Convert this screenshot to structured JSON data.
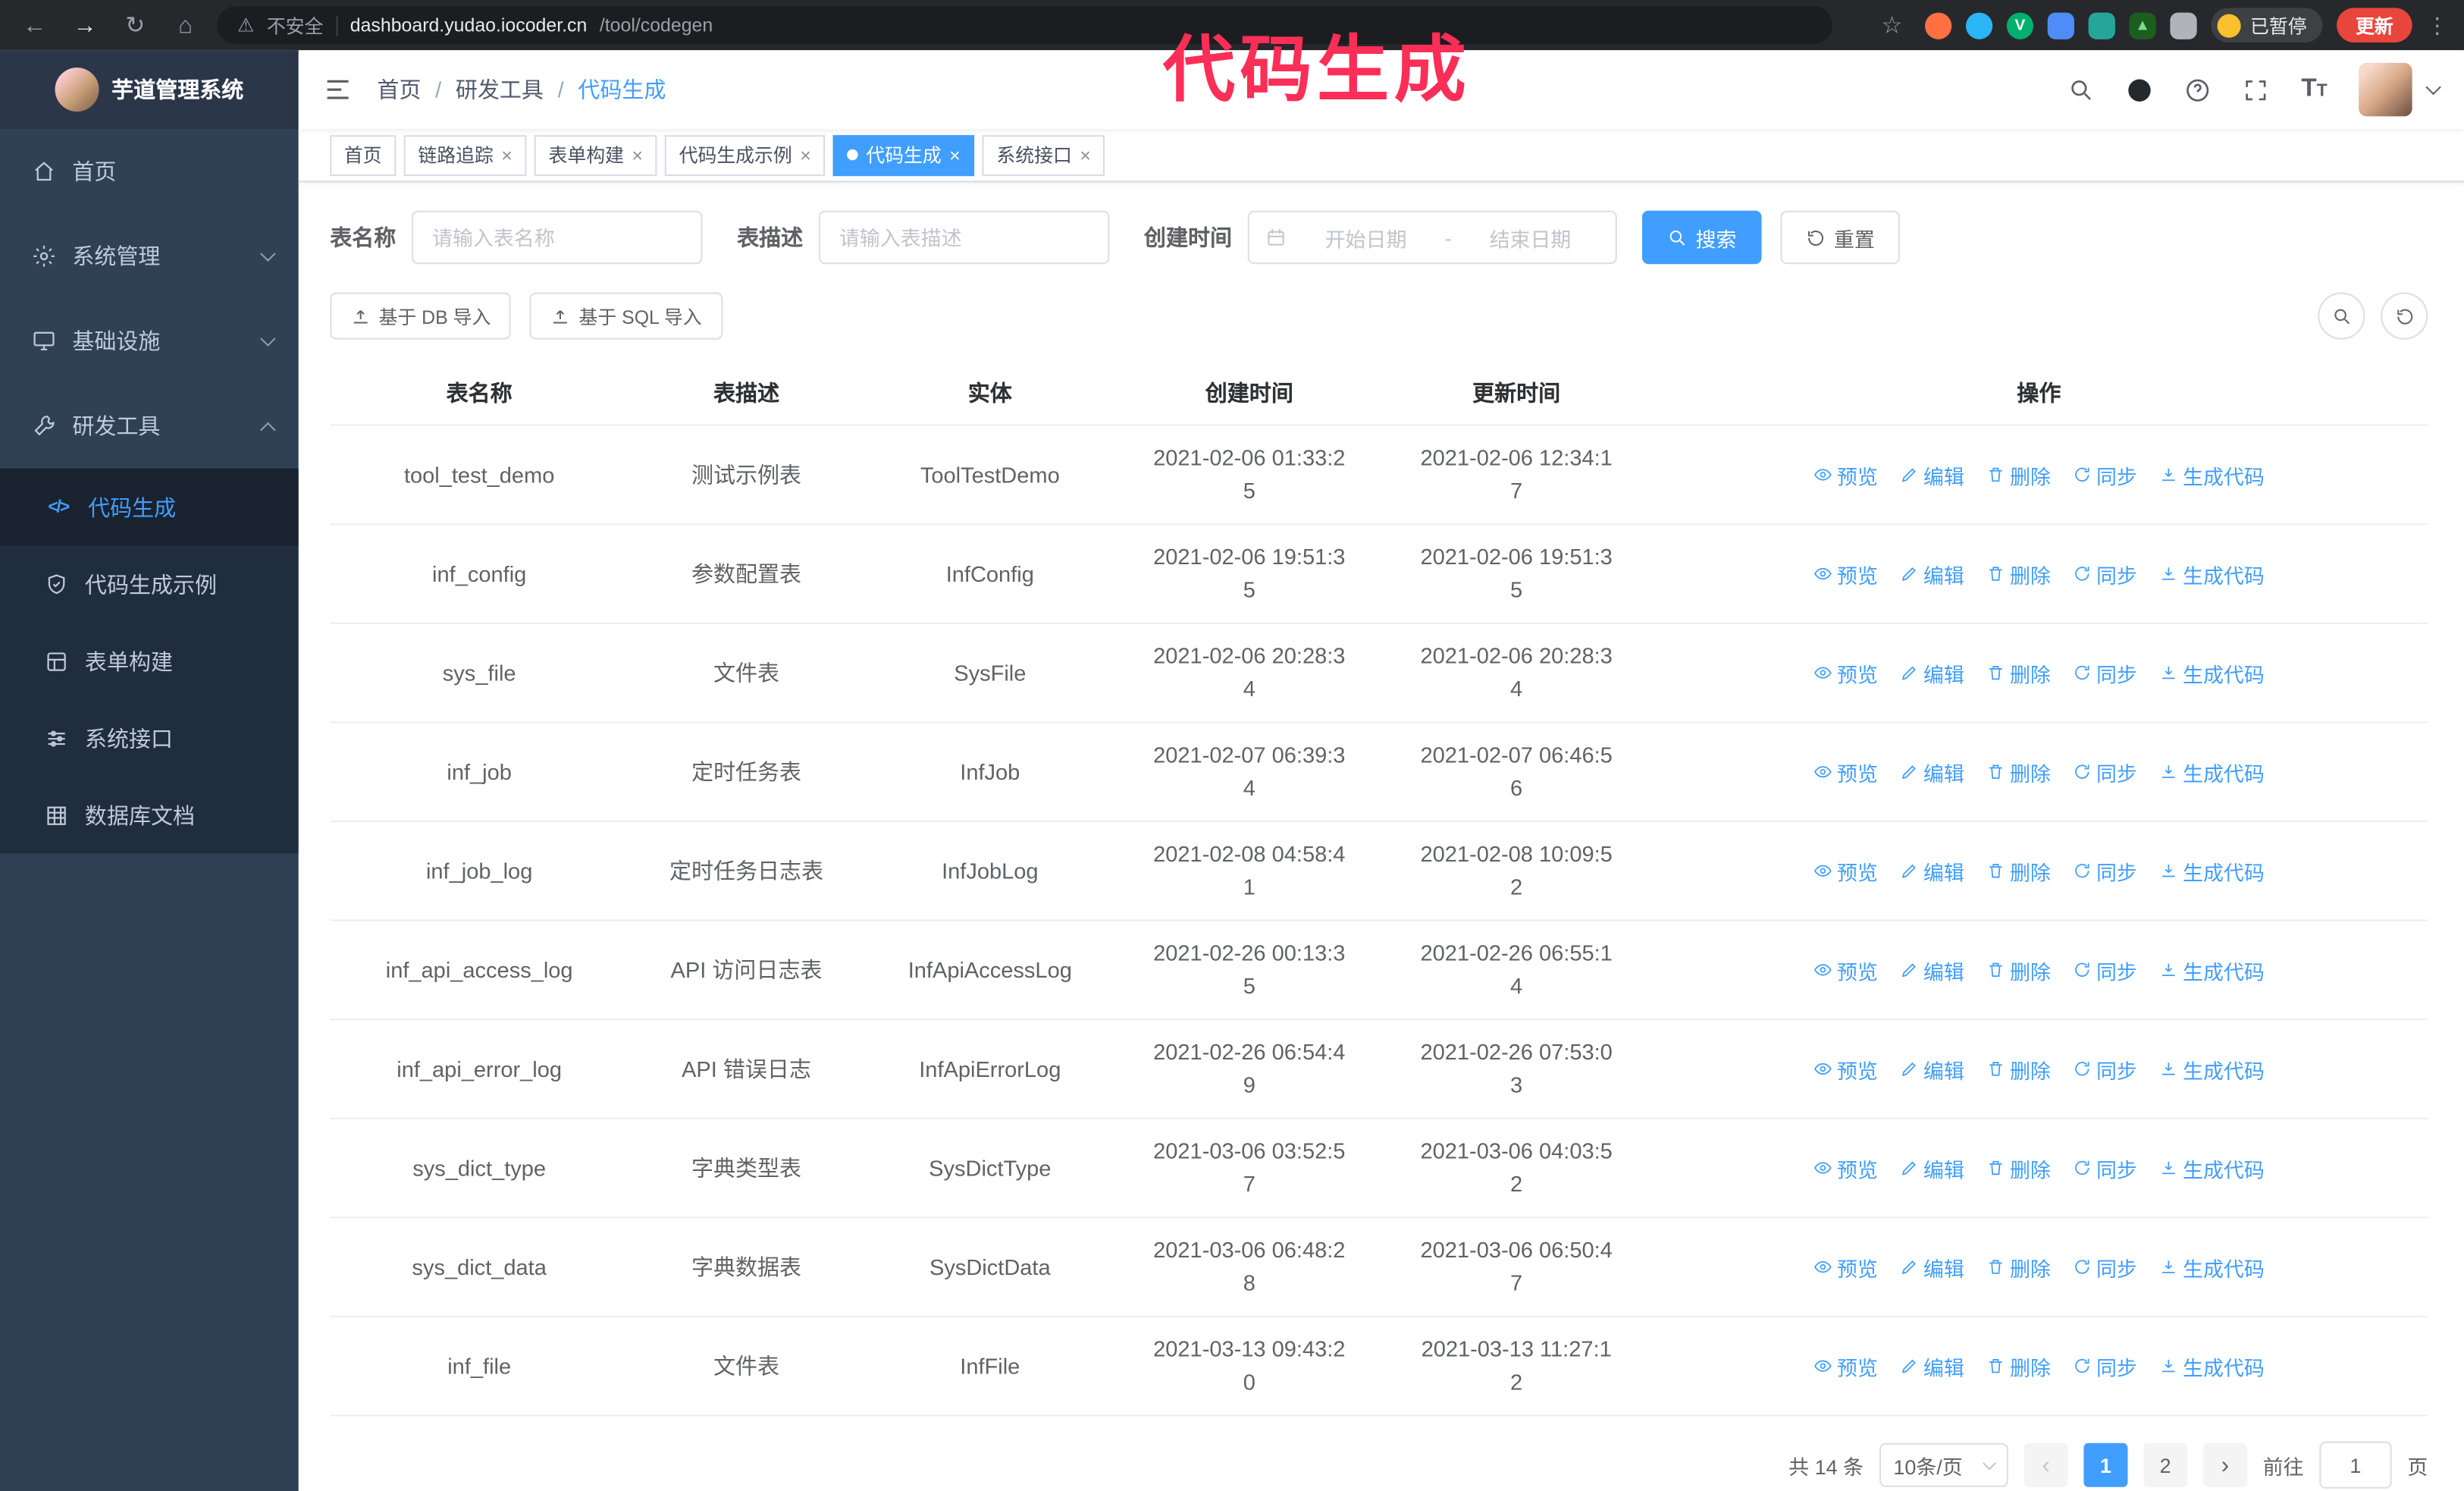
{
  "annotation": {
    "text": "代码生成",
    "color": "#fb2e57"
  },
  "theme": {
    "accent": "#409eff",
    "sidebar_bg": "#304156",
    "submenu_bg": "#1f2d3d",
    "active_tab_bg": "#409eff"
  },
  "browser": {
    "secure_label": "不安全",
    "url_host": "dashboard.yudao.iocoder.cn",
    "url_path": "/tool/codegen",
    "paused_badge": "已暂停",
    "update_button": "更新"
  },
  "sidebar": {
    "logo_title": "芋道管理系统",
    "items": [
      {
        "label": "首页"
      },
      {
        "label": "系统管理"
      },
      {
        "label": "基础设施"
      },
      {
        "label": "研发工具"
      }
    ],
    "sub_items": [
      {
        "label": "代码生成"
      },
      {
        "label": "代码生成示例"
      },
      {
        "label": "表单构建"
      },
      {
        "label": "系统接口"
      },
      {
        "label": "数据库文档"
      }
    ]
  },
  "header": {
    "breadcrumb": [
      "首页",
      "研发工具",
      "代码生成"
    ],
    "separator": "/"
  },
  "tabs": [
    {
      "label": "首页"
    },
    {
      "label": "链路追踪"
    },
    {
      "label": "表单构建"
    },
    {
      "label": "代码生成示例"
    },
    {
      "label": "代码生成"
    },
    {
      "label": "系统接口"
    }
  ],
  "filters": {
    "table_name_label": "表名称",
    "table_name_placeholder": "请输入表名称",
    "table_desc_label": "表描述",
    "table_desc_placeholder": "请输入表描述",
    "create_time_label": "创建时间",
    "date_start_placeholder": "开始日期",
    "date_separator": "-",
    "date_end_placeholder": "结束日期",
    "search_button": "搜索",
    "reset_button": "重置"
  },
  "toolbar": {
    "import_db": "基于 DB 导入",
    "import_sql": "基于 SQL 导入"
  },
  "table": {
    "columns": [
      "表名称",
      "表描述",
      "实体",
      "创建时间",
      "更新时间",
      "操作"
    ],
    "actions": [
      "预览",
      "编辑",
      "删除",
      "同步",
      "生成代码"
    ],
    "rows": [
      {
        "name": "tool_test_demo",
        "desc": "测试示例表",
        "entity": "ToolTestDemo",
        "created": "2021-02-06 01:33:25",
        "updated": "2021-02-06 12:34:17"
      },
      {
        "name": "inf_config",
        "desc": "参数配置表",
        "entity": "InfConfig",
        "created": "2021-02-06 19:51:35",
        "updated": "2021-02-06 19:51:35"
      },
      {
        "name": "sys_file",
        "desc": "文件表",
        "entity": "SysFile",
        "created": "2021-02-06 20:28:34",
        "updated": "2021-02-06 20:28:34"
      },
      {
        "name": "inf_job",
        "desc": "定时任务表",
        "entity": "InfJob",
        "created": "2021-02-07 06:39:34",
        "updated": "2021-02-07 06:46:56"
      },
      {
        "name": "inf_job_log",
        "desc": "定时任务日志表",
        "entity": "InfJobLog",
        "created": "2021-02-08 04:58:41",
        "updated": "2021-02-08 10:09:52"
      },
      {
        "name": "inf_api_access_log",
        "desc": "API 访问日志表",
        "entity": "InfApiAccessLog",
        "created": "2021-02-26 00:13:35",
        "updated": "2021-02-26 06:55:14"
      },
      {
        "name": "inf_api_error_log",
        "desc": "API 错误日志",
        "entity": "InfApiErrorLog",
        "created": "2021-02-26 06:54:49",
        "updated": "2021-02-26 07:53:03"
      },
      {
        "name": "sys_dict_type",
        "desc": "字典类型表",
        "entity": "SysDictType",
        "created": "2021-03-06 03:52:57",
        "updated": "2021-03-06 04:03:52"
      },
      {
        "name": "sys_dict_data",
        "desc": "字典数据表",
        "entity": "SysDictData",
        "created": "2021-03-06 06:48:28",
        "updated": "2021-03-06 06:50:47"
      },
      {
        "name": "inf_file",
        "desc": "文件表",
        "entity": "InfFile",
        "created": "2021-03-13 09:43:20",
        "updated": "2021-03-13 11:27:12"
      }
    ]
  },
  "pagination": {
    "total": "共 14 条",
    "page_size": "10条/页",
    "pages": [
      "1",
      "2"
    ],
    "active_page": "1",
    "goto_label": "前往",
    "goto_value": "1",
    "goto_suffix": "页"
  }
}
